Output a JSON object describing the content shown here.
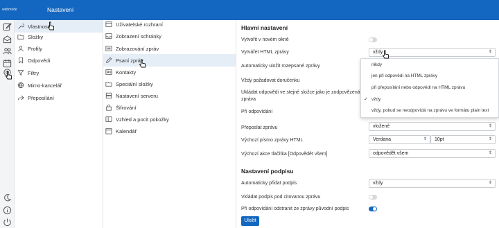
{
  "topbar": {
    "logo": "webmode",
    "title": "Nastavení"
  },
  "sections_nav": [
    {
      "label": "Vlastnosti",
      "icon": "wrench-icon",
      "active": true
    },
    {
      "label": "Složky",
      "icon": "folder-icon"
    },
    {
      "label": "Profily",
      "icon": "user-icon"
    },
    {
      "label": "Odpovědi",
      "icon": "bookmark-icon"
    },
    {
      "label": "Filtry",
      "icon": "filter-icon"
    },
    {
      "label": "Mimo-kancelář",
      "icon": "globe-icon"
    },
    {
      "label": "Přeposílání",
      "icon": "forward-icon"
    }
  ],
  "prefs_nav": [
    {
      "label": "Uživatelské rozhraní",
      "icon": "window-icon"
    },
    {
      "label": "Zobrazení schránky",
      "icon": "mailbox-icon"
    },
    {
      "label": "Zobrazování zpráv",
      "icon": "message-view-icon"
    },
    {
      "label": "Psaní zpráv",
      "icon": "pencil-icon",
      "active": true
    },
    {
      "label": "Kontakty",
      "icon": "contact-card-icon"
    },
    {
      "label": "Speciální složky",
      "icon": "folders-icon"
    },
    {
      "label": "Nastavení serveru",
      "icon": "server-icon"
    },
    {
      "label": "Šifrování",
      "icon": "lock-icon"
    },
    {
      "label": "Vzhled a pocit pokožky",
      "icon": "skin-icon"
    },
    {
      "label": "Kalendář",
      "icon": "calendar-icon"
    }
  ],
  "main": {
    "section_main": "Hlavní nastavení",
    "new_window_label": "Vytvořit v novém okně",
    "html_label": "Vytvářet HTML zprávy",
    "html_value": "vždy",
    "autosave_label": "Automaticky uložit rozepsané zprávy",
    "receipt_label": "Vždy požadovat doručenku",
    "save_replies_label": "Ukládat odpovědi ve stejné složce jako je zodpovězená zpráva",
    "reply_label": "Při odpovídání",
    "forward_label": "Přeposlat zprávu",
    "forward_value": "vložené",
    "font_label": "Výchozí písmo zprávy HTML",
    "font_value": "Verdana",
    "font_size_value": "10pt",
    "reply_all_label": "Výchozí akce tlačítka [Odpovědět všem]",
    "reply_all_value": "odpovědět všem",
    "section_signature": "Nastavení podpisu",
    "auto_sig_label": "Automaticky přidat podpis",
    "auto_sig_value": "vždy",
    "sig_below_label": "Vkládat podpis pod citovanou zprávu",
    "strip_sig_label": "Při odpovídání odstranit ze zprávy původní podpis",
    "save_button": "Uložit",
    "toggles": {
      "new_window": false,
      "sig_below": false,
      "strip_sig": true
    }
  },
  "html_dropdown": {
    "options": [
      "nikdy",
      "jen při odpovědi na HTML zprávy",
      "při přeposílání nebo odpovědi na HTML zprávu",
      "vždy",
      "vždy, pokud se neodpovídá na zprávu ve formátu plain text"
    ],
    "selected": "vždy",
    "check_mark": "✓"
  },
  "colors": {
    "accent": "#1467c0",
    "active_bg": "#e5edf7"
  }
}
